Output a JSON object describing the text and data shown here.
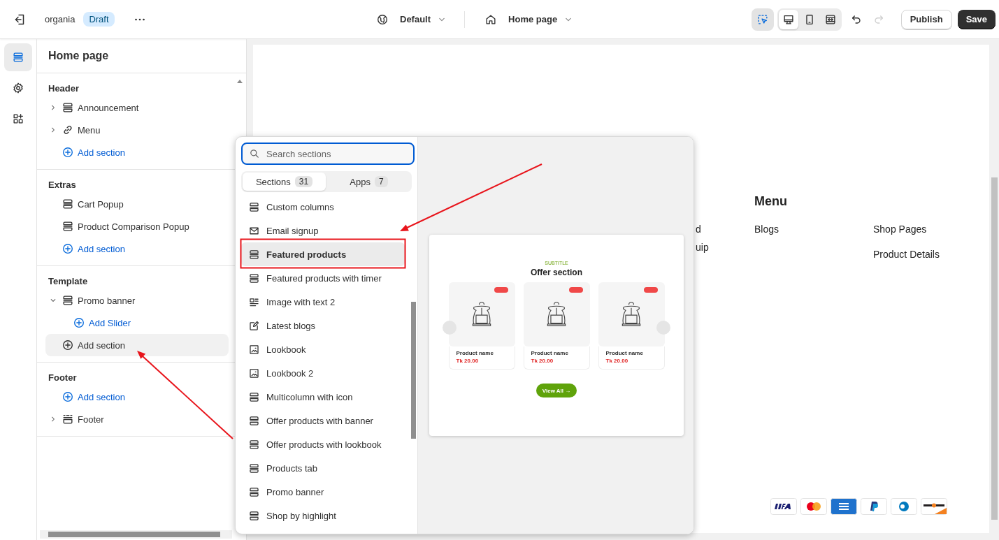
{
  "topbar": {
    "store": "organia",
    "status_badge": "Draft",
    "theme": "Default",
    "page": "Home page",
    "inspect_on": true,
    "view_modes": [
      {
        "kind": "desktop",
        "selected": true
      },
      {
        "kind": "mobile",
        "selected": false
      },
      {
        "kind": "fullscreen",
        "selected": false
      }
    ],
    "redo_disabled": true,
    "publish": "Publish",
    "save": "Save"
  },
  "rail": [
    {
      "kind": "sections",
      "selected": true
    },
    {
      "kind": "gear",
      "selected": false
    },
    {
      "kind": "apps",
      "selected": false
    }
  ],
  "sidebar": {
    "title": "Home page",
    "groups": [
      {
        "title": "Header",
        "items": [
          {
            "kind": "section",
            "label": "Announcement",
            "expanded": false,
            "selected": false
          },
          {
            "kind": "link",
            "label": "Menu",
            "expanded": false,
            "selected": false
          },
          {
            "kind": "add",
            "label": "Add section",
            "selected": false
          }
        ]
      },
      {
        "title": "Extras",
        "items": [
          {
            "kind": "section",
            "label": "Cart Popup",
            "selected": false
          },
          {
            "kind": "section",
            "label": "Product Comparison Popup",
            "selected": false
          },
          {
            "kind": "add",
            "label": "Add section",
            "selected": false
          }
        ]
      },
      {
        "title": "Template",
        "items": [
          {
            "kind": "section",
            "label": "Promo banner",
            "expanded": true,
            "selected": false,
            "children": [
              {
                "kind": "add",
                "label": "Add Slider",
                "selected": false
              }
            ]
          },
          {
            "kind": "add",
            "label": "Add section",
            "selected": true
          }
        ]
      },
      {
        "title": "Footer",
        "items": [
          {
            "kind": "add",
            "label": "Add section",
            "selected": false
          },
          {
            "kind": "footer",
            "label": "Footer",
            "expanded": false,
            "selected": false
          }
        ]
      }
    ]
  },
  "popup": {
    "search": {
      "placeholder": "Search sections"
    },
    "tabs": [
      {
        "label": "Sections",
        "count": "31",
        "selected": true
      },
      {
        "label": "Apps",
        "count": "7",
        "selected": false
      }
    ],
    "sections": [
      {
        "kind": "section",
        "label": "Custom columns",
        "selected": false
      },
      {
        "kind": "mail",
        "label": "Email signup",
        "selected": false
      },
      {
        "kind": "section",
        "label": "Featured products",
        "selected": true
      },
      {
        "kind": "section",
        "label": "Featured products with timer",
        "selected": false
      },
      {
        "kind": "textimage",
        "label": "Image with text 2",
        "selected": false
      },
      {
        "kind": "edit",
        "label": "Latest blogs",
        "selected": false
      },
      {
        "kind": "image",
        "label": "Lookbook",
        "selected": false
      },
      {
        "kind": "image",
        "label": "Lookbook 2",
        "selected": false
      },
      {
        "kind": "section",
        "label": "Multicolumn with icon",
        "selected": false
      },
      {
        "kind": "section",
        "label": "Offer products with banner",
        "selected": false
      },
      {
        "kind": "section",
        "label": "Offer products with lookbook",
        "selected": false
      },
      {
        "kind": "section",
        "label": "Products tab",
        "selected": false
      },
      {
        "kind": "section",
        "label": "Promo banner",
        "selected": false
      },
      {
        "kind": "section",
        "label": "Shop by highlight",
        "selected": false
      }
    ],
    "preview": {
      "subtitle": "SUBTITLE",
      "title": "Offer section",
      "products": [
        {
          "name": "Product name",
          "price": "Tk 20.00"
        },
        {
          "name": "Product name",
          "price": "Tk 20.00"
        },
        {
          "name": "Product name",
          "price": "Tk 20.00"
        }
      ],
      "button": "View All →"
    }
  },
  "canvas": {
    "fragments": [
      "d",
      "uip"
    ],
    "menu_title": "Menu",
    "column_1": [
      "Blogs"
    ],
    "column_2": [
      "Shop Pages",
      "Product Details"
    ],
    "payment_icons": [
      {
        "kind": "visa"
      },
      {
        "kind": "mastercard"
      },
      {
        "kind": "amex"
      },
      {
        "kind": "paypal"
      },
      {
        "kind": "diners"
      },
      {
        "kind": "discover"
      }
    ]
  }
}
